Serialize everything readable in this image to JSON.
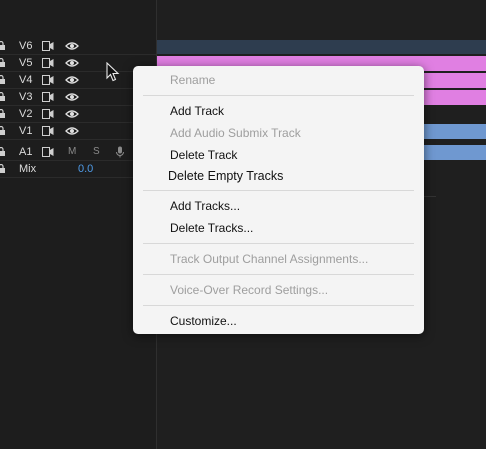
{
  "tracks": [
    {
      "name": "V6",
      "type": "video"
    },
    {
      "name": "V5",
      "type": "video"
    },
    {
      "name": "V4",
      "type": "video"
    },
    {
      "name": "V3",
      "type": "video"
    },
    {
      "name": "V2",
      "type": "video"
    },
    {
      "name": "V1",
      "type": "video"
    },
    {
      "name": "A1",
      "type": "audio",
      "mute_label": "M",
      "solo_label": "S"
    },
    {
      "name": "Mix",
      "type": "mix",
      "value": "0.0"
    }
  ],
  "colors": {
    "background": "#1d1d1d",
    "clip_dark": "#2e3d4f",
    "clip_pink": "#e07fe2",
    "clip_blue": "#6f98d0",
    "accent_value": "#4f9be8"
  },
  "context_menu": {
    "items": [
      {
        "label": "Rename",
        "enabled": false
      },
      {
        "label": "Add Track",
        "enabled": true
      },
      {
        "label": "Add Audio Submix Track",
        "enabled": false
      },
      {
        "label": "Delete Track",
        "enabled": true
      },
      {
        "label": "Delete Empty Tracks",
        "enabled": true
      },
      {
        "label": "Add Tracks...",
        "enabled": true
      },
      {
        "label": "Delete Tracks...",
        "enabled": true
      },
      {
        "label": "Track Output Channel Assignments...",
        "enabled": false
      },
      {
        "label": "Voice-Over Record Settings...",
        "enabled": false
      },
      {
        "label": "Customize...",
        "enabled": true
      }
    ]
  },
  "icons": {
    "lock": "lock-icon",
    "sync": "sync-lock-icon",
    "eye": "eye-icon",
    "mic": "microphone-icon",
    "cursor": "mouse-pointer-icon"
  }
}
